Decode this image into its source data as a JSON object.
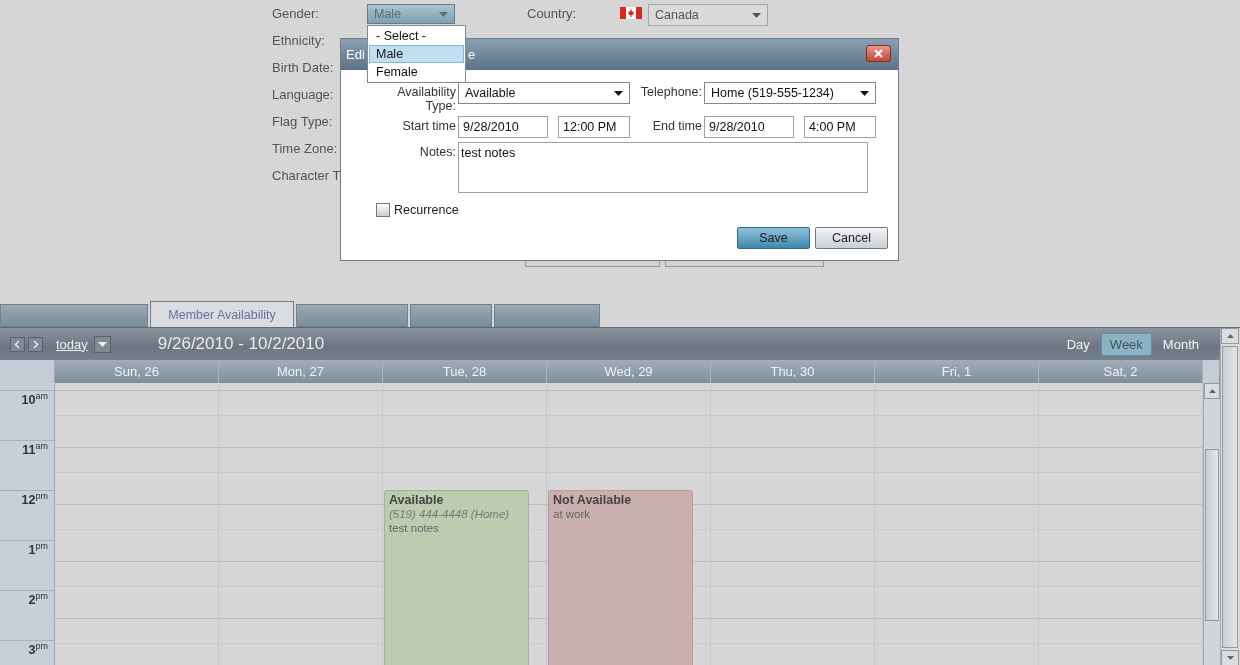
{
  "form": {
    "left": [
      {
        "label": "Gender:",
        "kind": "select",
        "value": "Male"
      },
      {
        "label": "Ethnicity:",
        "kind": "label"
      },
      {
        "label": "Birth Date:",
        "kind": "label"
      },
      {
        "label": "Language:",
        "kind": "label"
      },
      {
        "label": "Flag Type:",
        "kind": "label"
      },
      {
        "label": "Time Zone:",
        "kind": "label"
      },
      {
        "label": "Character T",
        "kind": "label"
      }
    ],
    "country": {
      "label": "Country:",
      "value": "Canada"
    }
  },
  "gender_dropdown": {
    "options": [
      {
        "label": "- Select -",
        "selected": false
      },
      {
        "label": "Male",
        "selected": true
      },
      {
        "label": "Female",
        "selected": false
      }
    ]
  },
  "dialog": {
    "title_parts": [
      "Edi",
      "e"
    ],
    "availability_type": {
      "label": "Availability Type:",
      "value": "Available"
    },
    "telephone": {
      "label": "Telephone:",
      "value": "Home (519-555-1234)"
    },
    "start": {
      "label": "Start time",
      "date": "9/28/2010",
      "time": "12:00 PM"
    },
    "end": {
      "label": "End time",
      "date": "9/28/2010",
      "time": "4:00 PM"
    },
    "notes": {
      "label": "Notes:",
      "value": "test notes"
    },
    "recurrence": {
      "label": "Recurrence",
      "checked": false
    },
    "buttons": [
      {
        "label": "Save",
        "kind": "primary"
      },
      {
        "label": "Cancel",
        "kind": "secondary"
      }
    ]
  },
  "tabs": [
    {
      "selected": false
    },
    {
      "label": "Member Availability",
      "selected": true
    },
    {
      "selected": false
    },
    {
      "selected": false
    },
    {
      "selected": false
    }
  ],
  "calendar": {
    "today": "today",
    "range": "9/26/2010 - 10/2/2010",
    "views": [
      {
        "label": "Day",
        "selected": false
      },
      {
        "label": "Week",
        "selected": true
      },
      {
        "label": "Month",
        "selected": false
      }
    ],
    "hours": [
      {
        "hour": "10",
        "period": "am"
      },
      {
        "hour": "11",
        "period": "am"
      },
      {
        "hour": "12",
        "period": "pm"
      },
      {
        "hour": "1",
        "period": "pm"
      },
      {
        "hour": "2",
        "period": "pm"
      },
      {
        "hour": "3",
        "period": "pm"
      }
    ],
    "days": [
      {
        "label": "Sun, 26"
      },
      {
        "label": "Mon, 27"
      },
      {
        "label": "Tue, 28",
        "events": [
          {
            "kind": "available",
            "title": "Available",
            "phone": "(519) 444-4448 (Home)",
            "notes": "test notes"
          }
        ]
      },
      {
        "label": "Wed, 29",
        "events": [
          {
            "kind": "unavailable",
            "title": "Not Available",
            "notes": "at work"
          }
        ]
      },
      {
        "label": "Thu, 30"
      },
      {
        "label": "Fri, 1"
      },
      {
        "label": "Sat, 2"
      }
    ]
  }
}
